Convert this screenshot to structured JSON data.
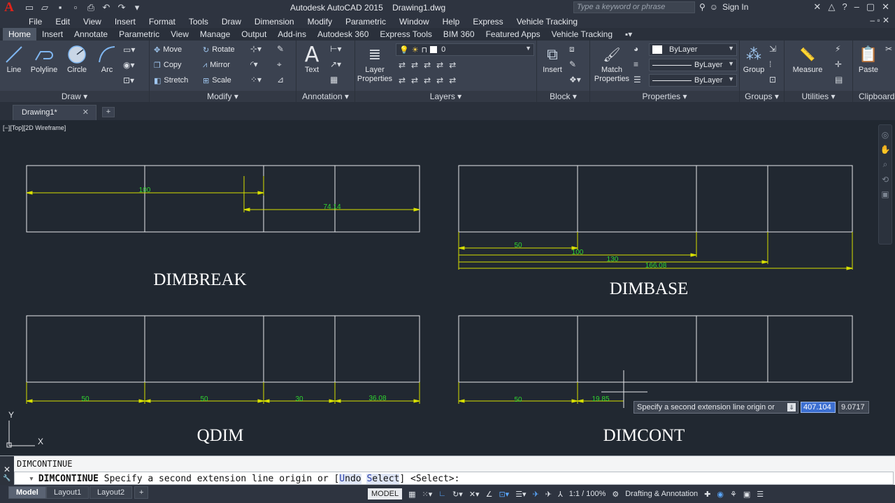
{
  "app": {
    "logo": "A",
    "title": "Autodesk AutoCAD 2015",
    "document": "Drawing1.dwg",
    "search_placeholder": "Type a keyword or phrase",
    "sign_in": "Sign In"
  },
  "menu": [
    "File",
    "Edit",
    "View",
    "Insert",
    "Format",
    "Tools",
    "Draw",
    "Dimension",
    "Modify",
    "Parametric",
    "Window",
    "Help",
    "Express",
    "Vehicle Tracking"
  ],
  "ribbon_tabs": [
    "Home",
    "Insert",
    "Annotate",
    "Parametric",
    "View",
    "Manage",
    "Output",
    "Add-ins",
    "Autodesk 360",
    "Express Tools",
    "BIM 360",
    "Featured Apps",
    "Vehicle Tracking"
  ],
  "ribbon": {
    "draw": {
      "title": "Draw",
      "tools": [
        "Line",
        "Polyline",
        "Circle",
        "Arc"
      ]
    },
    "modify": {
      "title": "Modify",
      "tools": [
        "Move",
        "Rotate",
        "Copy",
        "Mirror",
        "Stretch",
        "Scale"
      ]
    },
    "annotation": {
      "title": "Annotation",
      "text": "Text"
    },
    "layers": {
      "title": "Layers",
      "layer_properties": "Layer Properties",
      "current_layer": "0"
    },
    "block": {
      "title": "Block",
      "insert": "Insert"
    },
    "properties": {
      "title": "Properties",
      "match": "Match Properties",
      "color": "ByLayer",
      "linetype": "ByLayer",
      "lineweight": "ByLayer"
    },
    "groups": {
      "title": "Groups",
      "group": "Group"
    },
    "utilities": {
      "title": "Utilities",
      "measure": "Measure"
    },
    "clipboard": {
      "title": "Clipboard",
      "paste": "Paste"
    }
  },
  "file_tab": {
    "name": "Drawing1*",
    "close": "✕",
    "new": "+"
  },
  "viewport_label": "[−][Top][2D Wireframe]",
  "drawing": {
    "labels": {
      "dimbreak": "DIMBREAK",
      "dimbase": "DIMBASE",
      "qdim": "QDIM",
      "dimcont": "DIMCONT"
    },
    "dimbreak_dims": [
      "100",
      "74.14"
    ],
    "dimbase_dims": [
      "50",
      "100",
      "130",
      "166.08"
    ],
    "qdim_dims": [
      "50",
      "50",
      "30",
      "36.08"
    ],
    "dimcont_dims": [
      "50",
      "19.85"
    ],
    "ucs": {
      "x": "X",
      "y": "Y"
    }
  },
  "dynamic_input": {
    "prompt": "Specify a second extension line origin or",
    "x_value": "407.104",
    "y_value": "9.0717"
  },
  "command_line": {
    "history": "DIMCONTINUE",
    "cmd": "DIMCONTINUE",
    "prompt": "Specify a second extension line origin or [",
    "opt_undo_key": "U",
    "opt_undo_rest": "ndo",
    "opt_select_key": "S",
    "opt_select_rest": "elect",
    "tail": "] <Select>:"
  },
  "status": {
    "layouts": [
      "Model",
      "Layout1",
      "Layout2"
    ],
    "model": "MODEL",
    "scale": "1:1 / 100%",
    "workspace": "Drafting & Annotation"
  },
  "colors": {
    "dim": "#d8e000",
    "dim_text": "#2fd52f",
    "geometry": "#e6e8ec",
    "background": "#212831"
  }
}
